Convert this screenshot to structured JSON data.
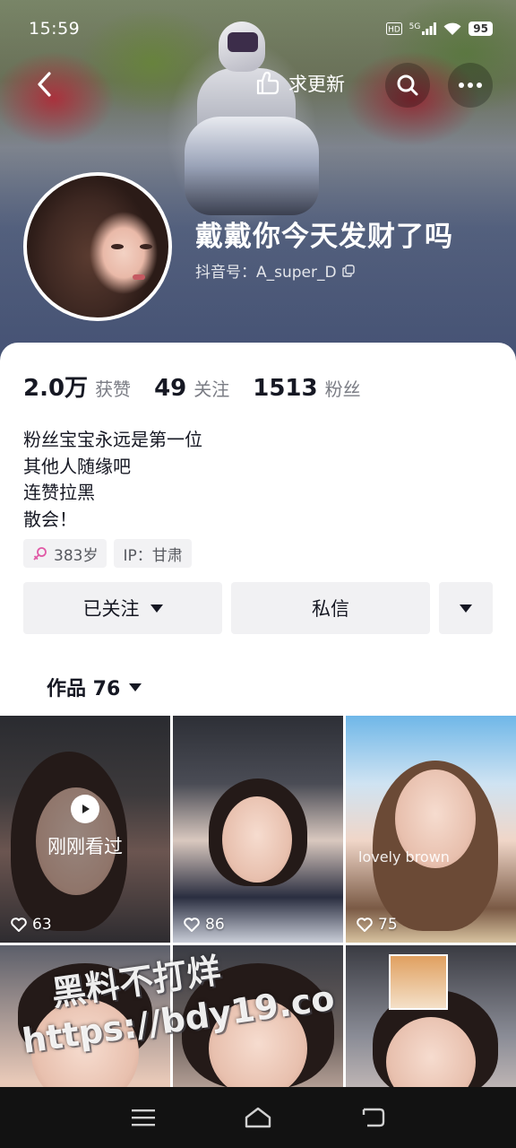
{
  "status_bar": {
    "time": "15:59",
    "hd": "HD",
    "network": "5G",
    "battery": "95"
  },
  "top_nav": {
    "update_label": "求更新"
  },
  "profile": {
    "nickname": "戴戴你今天发财了吗",
    "douyin_id": "抖音号：A_super_D"
  },
  "stats": [
    {
      "value": "2.0万",
      "label": "获赞"
    },
    {
      "value": "49",
      "label": "关注"
    },
    {
      "value": "1513",
      "label": "粉丝"
    }
  ],
  "bio": [
    "粉丝宝宝永远是第一位",
    "其他人随缘吧",
    "连赞拉黑",
    "散会！"
  ],
  "tags": {
    "age": "383岁",
    "ip": "IP：甘肃"
  },
  "actions": {
    "follow": "已关注",
    "message": "私信"
  },
  "works_tab": {
    "label": "作品 76"
  },
  "videos": [
    {
      "likes": "63",
      "overlay": "刚刚看过"
    },
    {
      "likes": "86"
    },
    {
      "likes": "75",
      "caption": "lovely brown"
    }
  ],
  "watermark": {
    "line1": "黑料不打烊",
    "line2": "https://bdy19.co"
  },
  "colors": {
    "accent_text": "#161823",
    "secondary_text": "#7b7d85",
    "button_bg": "#f1f1f3",
    "female_icon": "#e05aa6"
  }
}
